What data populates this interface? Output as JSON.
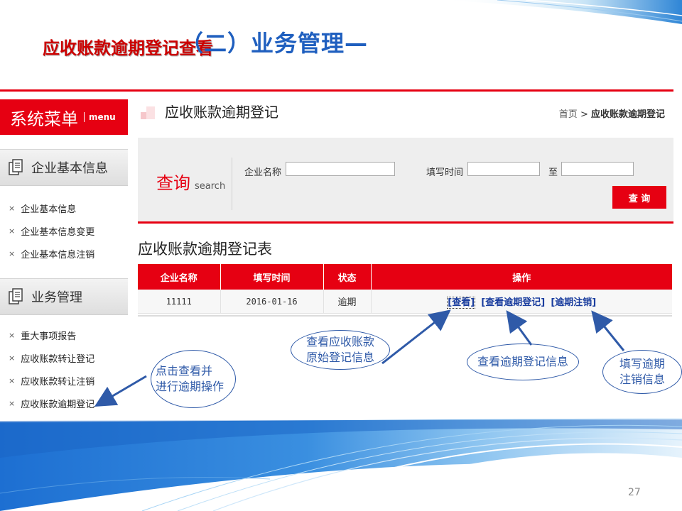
{
  "slide": {
    "title_main": "（二）业务管理—",
    "title_sub": "应收账款逾期登记查看",
    "page_number": "27"
  },
  "sidebar": {
    "header_title": "系统菜单",
    "header_sub": "menu",
    "sections": [
      {
        "label": "企业基本信息",
        "items": [
          "企业基本信息",
          "企业基本信息变更",
          "企业基本信息注销"
        ]
      },
      {
        "label": "业务管理",
        "items": [
          "重大事项报告",
          "应收账款转让登记",
          "应收账款转让注销",
          "应收账款逾期登记"
        ]
      }
    ]
  },
  "main": {
    "page_title": "应收账款逾期登记",
    "breadcrumb": {
      "home": "首页",
      "sep": ">",
      "current": "应收账款逾期登记"
    },
    "search": {
      "label": "查询",
      "label_en": "search",
      "company_label": "企业名称",
      "company_value": "",
      "date_label": "填写时间",
      "date_from": "",
      "to_label": "至",
      "date_to": "",
      "query_button": "查 询"
    },
    "table": {
      "title": "应收账款逾期登记表",
      "columns": [
        "企业名称",
        "填写时间",
        "状态",
        "操作"
      ],
      "rows": [
        {
          "company": "11111",
          "date": "2016-01-16",
          "status": "逾期",
          "ops": [
            "[查看]",
            "[查看逾期登记]",
            "[逾期注销]"
          ]
        }
      ]
    }
  },
  "callouts": {
    "sidebar_tip": "点击查看并\n进行逾期操作",
    "view_tip": "查看应收账款\n原始登记信息",
    "view_overdue_tip": "查看逾期登记信息",
    "cancel_tip": "填写逾期\n注销信息"
  },
  "colors": {
    "accent_red": "#e60012",
    "title_blue": "#1f5fbf",
    "link_blue": "#1a3d9e",
    "callout_blue": "#2f5aa8"
  }
}
